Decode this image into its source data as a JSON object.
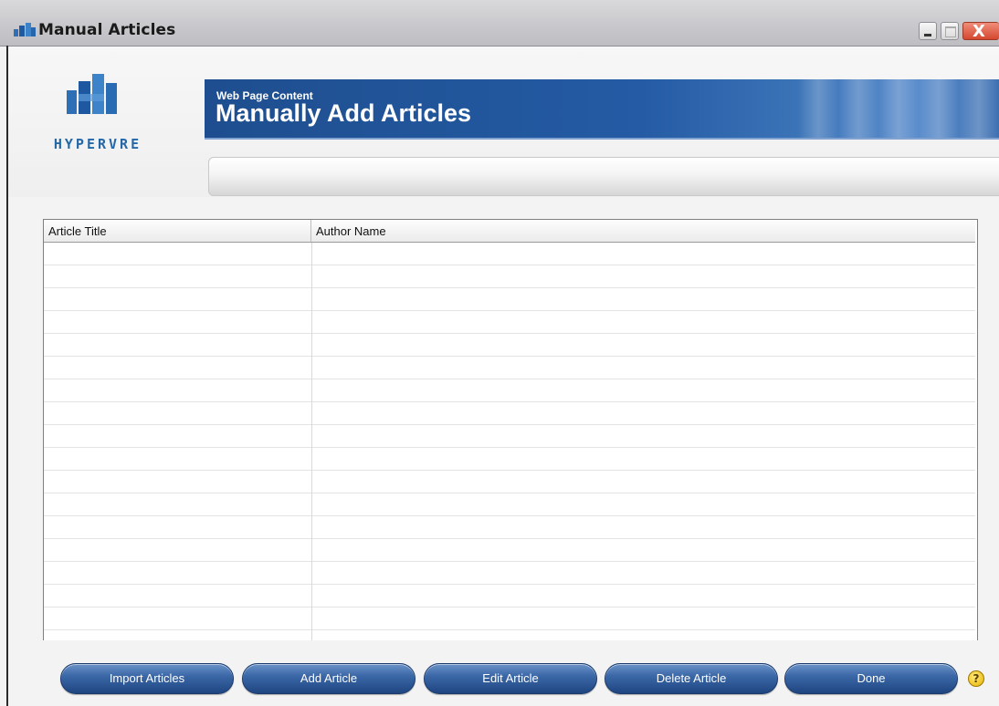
{
  "window": {
    "title": "Manual Articles",
    "close_glyph": "X"
  },
  "logo": {
    "text": "HYPERVRE",
    "icon": "hypervre-buildings-logo"
  },
  "banner": {
    "subtitle": "Web Page Content",
    "title": "Manually Add Articles"
  },
  "table": {
    "columns": [
      "Article Title",
      "Author Name"
    ],
    "rows": []
  },
  "buttons": {
    "import": "Import Articles",
    "add": "Add Article",
    "edit": "Edit Article",
    "delete": "Delete Article",
    "done": "Done"
  },
  "help": {
    "glyph": "?",
    "icon": "help-icon"
  },
  "colors": {
    "banner_blue": "#245ba4",
    "button_blue": "#3c68a8",
    "logo_blue": "#2567a7"
  }
}
